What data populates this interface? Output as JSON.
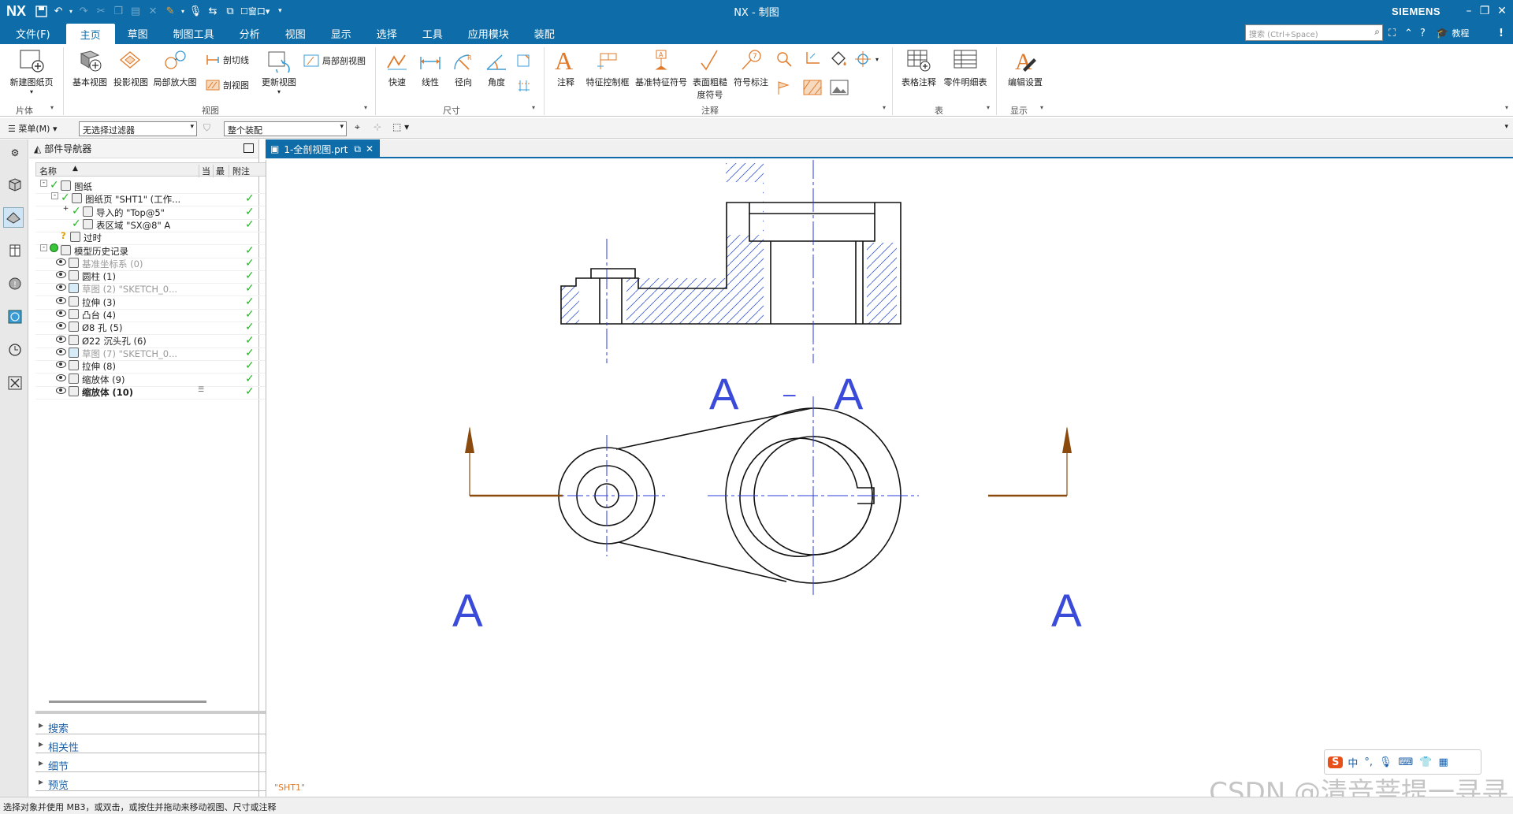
{
  "titlebar": {
    "logo": "NX",
    "title": "NX - 制图",
    "brand": "SIEMENS",
    "window_menu": "窗口"
  },
  "menu": {
    "tabs": [
      "文件(F)",
      "主页",
      "草图",
      "制图工具",
      "分析",
      "视图",
      "显示",
      "选择",
      "工具",
      "应用模块",
      "装配"
    ],
    "search_placeholder": "搜索 (Ctrl+Space)",
    "tutorial": "教程"
  },
  "ribbon": {
    "new_sheet": "新建图纸页",
    "base_view": "基本视图",
    "proj_view": "投影视图",
    "detail_view": "局部放大图",
    "section_line": "剖切线",
    "section_view": "剖视图",
    "update_view": "更新视图",
    "break_view": "局部剖视图",
    "quick": "快速",
    "linear": "线性",
    "radial": "径向",
    "angle": "角度",
    "note": "注释",
    "fcf": "特征控制框",
    "datum": "基准特征符号",
    "surface": "表面粗糙度符号",
    "balloon": "符号标注",
    "table_note": "表格注释",
    "parts_list": "零件明细表",
    "edit_settings": "编辑设置",
    "groups": {
      "sheet": "片体",
      "view": "视图",
      "dimension": "尺寸",
      "annotation": "注释",
      "table": "表",
      "display": "显示"
    }
  },
  "selbar": {
    "menu": "菜单(M)",
    "filter": "无选择过滤器",
    "scope": "整个装配"
  },
  "navigator": {
    "title": "部件导航器",
    "columns": {
      "name": "名称",
      "current": "当",
      "latest": "最",
      "note": "附注"
    },
    "rows": [
      {
        "label": "图纸",
        "indent": 0
      },
      {
        "label": "图纸页 \"SHT1\" (工作...",
        "indent": 1
      },
      {
        "label": "导入的 \"Top@5\"",
        "indent": 2
      },
      {
        "label": "表区域 \"SX@8\" A",
        "indent": 2
      },
      {
        "label": "过时",
        "indent": 1
      },
      {
        "label": "模型历史记录",
        "indent": 0
      },
      {
        "label": "基准坐标系 (0)",
        "indent": 1,
        "grey": true
      },
      {
        "label": "圆柱 (1)",
        "indent": 1
      },
      {
        "label": "草图 (2) \"SKETCH_0...",
        "indent": 1,
        "grey": true
      },
      {
        "label": "拉伸 (3)",
        "indent": 1
      },
      {
        "label": "凸台 (4)",
        "indent": 1
      },
      {
        "label": "Ø8 孔 (5)",
        "indent": 1
      },
      {
        "label": "Ø22 沉头孔 (6)",
        "indent": 1
      },
      {
        "label": "草图 (7) \"SKETCH_0...",
        "indent": 1,
        "grey": true
      },
      {
        "label": "拉伸 (8)",
        "indent": 1
      },
      {
        "label": "缩放体 (9)",
        "indent": 1
      },
      {
        "label": "缩放体 (10)",
        "indent": 1,
        "bold": true
      }
    ],
    "sections": [
      "搜索",
      "相关性",
      "细节",
      "预览"
    ]
  },
  "document": {
    "tab": "1-全剖视图.prt",
    "sheet": "\"SHT1\""
  },
  "drawing": {
    "section_label_left": "A",
    "section_dash": "–",
    "section_label_right": "A",
    "arrow_label": "A"
  },
  "status": {
    "message": "选择对象并使用 MB3，或双击，或按住并拖动来移动视图、尺寸或注释"
  },
  "ime": {
    "text": "中"
  },
  "watermark": {
    "text": "CSDN @清音菩提一寻寻"
  },
  "colors": {
    "accent": "#0e6da8",
    "check": "#21b521",
    "centerline": "#2a3ddb",
    "hatch": "#3b5bd6",
    "arrow": "#8a4a0e"
  }
}
